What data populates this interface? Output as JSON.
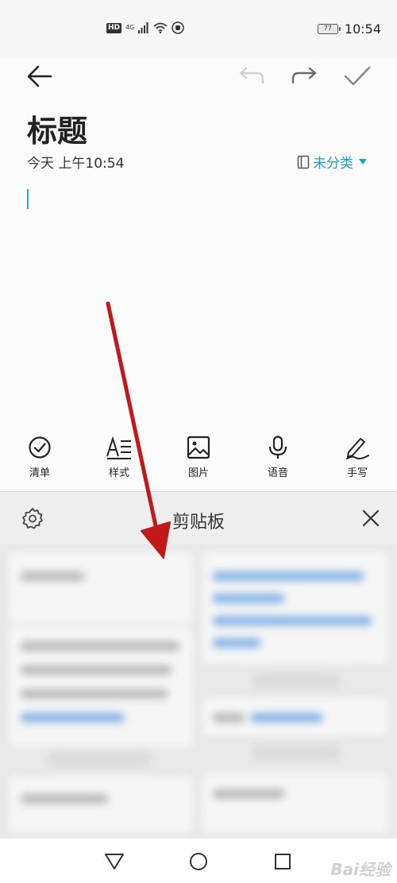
{
  "status_bar": {
    "hd": "HD",
    "network": "4G",
    "battery": "77",
    "time": "10:54"
  },
  "toolbar": {
    "back_icon": "arrow-left-icon",
    "undo_icon": "undo-icon",
    "redo_icon": "redo-icon",
    "done_icon": "checkmark-icon",
    "undo_enabled": false
  },
  "note": {
    "title": "标题",
    "timestamp": "今天 上午10:54",
    "category": "未分类",
    "category_icon": "notebook-icon"
  },
  "tools": [
    {
      "label": "清单",
      "icon": "checklist-icon"
    },
    {
      "label": "样式",
      "icon": "text-style-icon"
    },
    {
      "label": "图片",
      "icon": "image-icon"
    },
    {
      "label": "语音",
      "icon": "microphone-icon"
    },
    {
      "label": "手写",
      "icon": "handwriting-pen-icon"
    }
  ],
  "clipboard": {
    "title": "剪贴板",
    "settings_icon": "gear-icon",
    "close_icon": "close-icon"
  },
  "nav": {
    "back_icon": "nav-back-triangle-icon",
    "home_icon": "nav-home-circle-icon",
    "recents_icon": "nav-recents-square-icon"
  },
  "watermark": "Bai经验",
  "colors": {
    "accent": "#1a9fdb",
    "annotation_arrow": "#c0181b"
  }
}
